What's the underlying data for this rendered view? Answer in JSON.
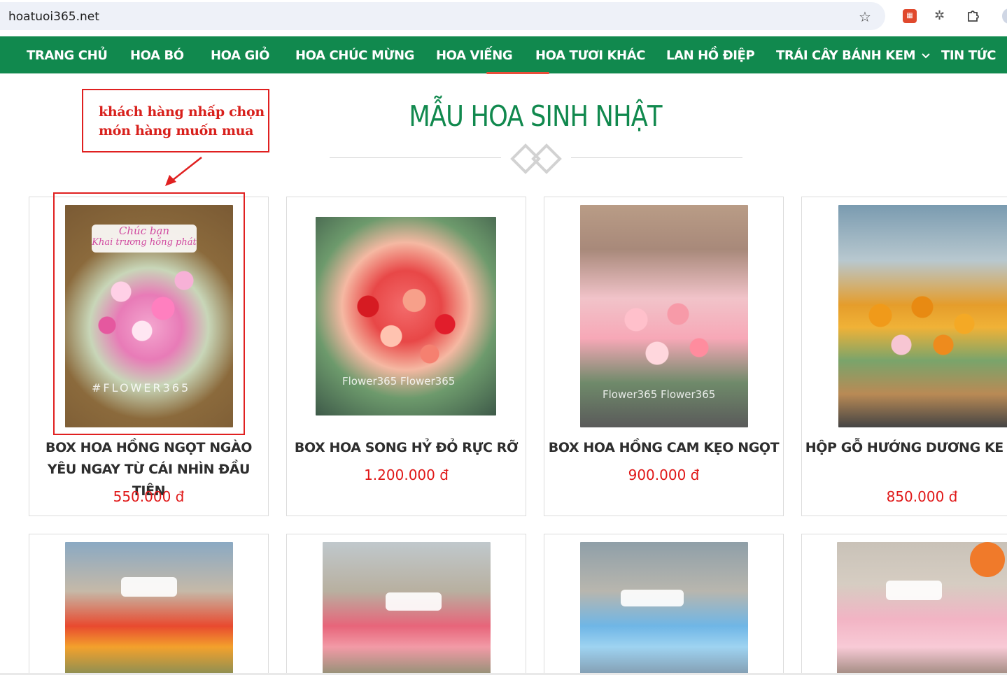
{
  "browser": {
    "url": "hoatuoi365.net",
    "bookmark_icon": "star-icon",
    "extension_icons": [
      "calendar-extension-icon",
      "gear-extension-icon",
      "puzzle-extension-icon",
      "profile-avatar"
    ]
  },
  "nav": {
    "items": [
      {
        "label": "TRANG CHỦ"
      },
      {
        "label": "HOA BÓ"
      },
      {
        "label": "HOA GIỎ"
      },
      {
        "label": "HOA CHÚC MỪNG"
      },
      {
        "label": "HOA VIẾNG"
      },
      {
        "label": "HOA TƯƠI KHÁC"
      },
      {
        "label": "LAN HỒ ĐIỆP"
      },
      {
        "label": "TRÁI CÂY BÁNH KEM"
      },
      {
        "label": "TIN TỨC"
      }
    ]
  },
  "section": {
    "title": "MẪU HOA SINH NHẬT"
  },
  "annotation": {
    "line1": "khách hàng nhấp chọn",
    "line2": "món hàng muốn mua"
  },
  "products": [
    {
      "name": "BOX HOA HỒNG NGỌT NGÀO YÊU NGAY TỪ CÁI NHÌN ĐẦU TIÊN",
      "price": "550.000 đ",
      "sign_line1": "Chúc bạn",
      "sign_line2": "Khai trương hồng phát",
      "watermark": "#FLOWER365"
    },
    {
      "name": "BOX HOA SONG HỶ ĐỎ RỰC RỠ",
      "price": "1.200.000 đ",
      "watermark": "Flower365  Flower365"
    },
    {
      "name": "BOX HOA HỒNG CAM KẸO NGỌT",
      "price": "900.000 đ",
      "watermark": "Flower365  Flower365"
    },
    {
      "name": "HỘP GỖ HƯỚNG DƯƠNG KE DÂU",
      "price": "850.000 đ"
    }
  ],
  "colors": {
    "brand_green": "#11894e",
    "price_red": "#e01818",
    "annotation_red": "#e02020"
  }
}
